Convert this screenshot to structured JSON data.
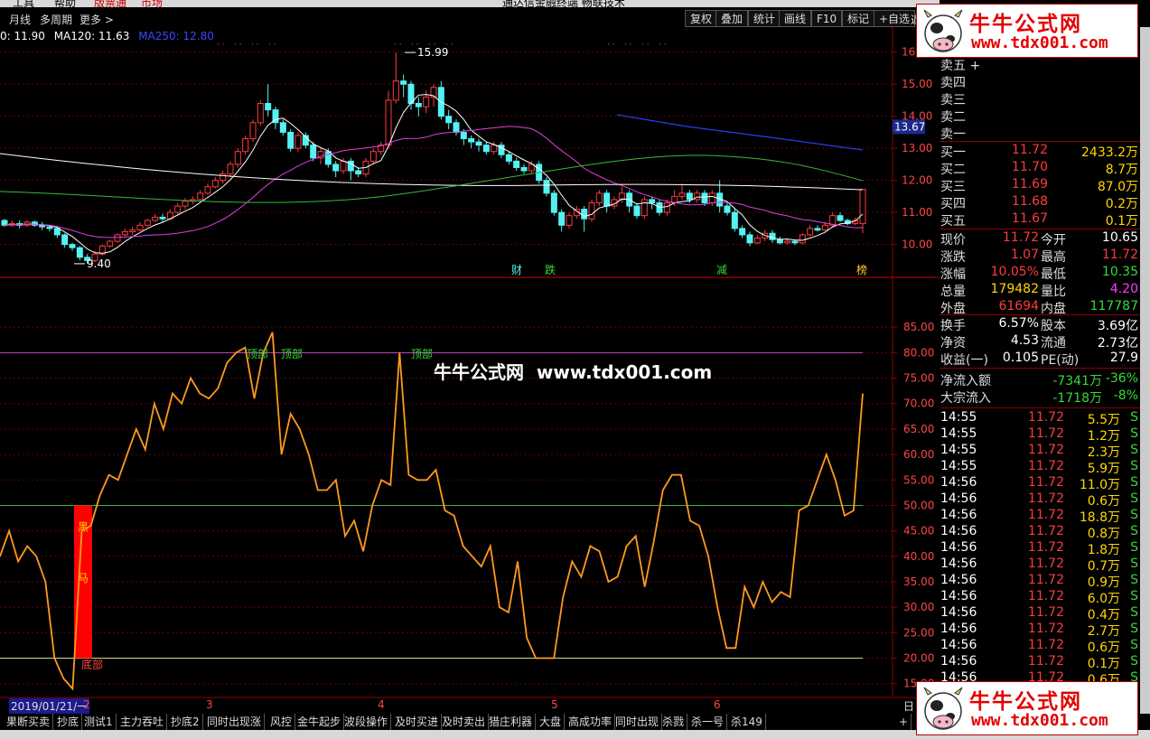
{
  "menu": {
    "items": [
      "工具",
      "帮助",
      "版票通",
      "市场"
    ],
    "center_title": "通达信金融终端 畅联技术"
  },
  "toolbar": {
    "left": [
      "月线",
      "多周期",
      "更多 >"
    ],
    "buttons": [
      "复权",
      "叠加",
      "统计",
      "画线",
      "F10",
      "标记",
      "+自选"
    ],
    "trail": "返"
  },
  "ma_legend": [
    {
      "text": "0: 11.90",
      "color": "#ffffff"
    },
    {
      "text": "MA120: 11.63",
      "color": "#ffffff"
    },
    {
      "text": "MA250: 12.80",
      "color": "#3c46ff"
    }
  ],
  "colors": {
    "up": "#ff3b3b",
    "down": "#54f2f2",
    "ma_white": "#ffffff",
    "ma_magenta": "#e040e0",
    "ma_green": "#38b838",
    "ma_blue": "#2a3cf0",
    "osc": "#ff9a1e",
    "grid": "#6b0000"
  },
  "price_axis": {
    "labels": [
      "16",
      "15.00",
      "14.00",
      "13.00",
      "12.00",
      "11.00",
      "10.00"
    ],
    "values": [
      16,
      15,
      14,
      13,
      12,
      11,
      10
    ],
    "current": "13.67"
  },
  "osc_axis": {
    "labels": [
      "85.00",
      "80.00",
      "75.00",
      "70.00",
      "65.00",
      "60.00",
      "55.00",
      "50.00",
      "45.00",
      "40.00",
      "35.00",
      "30.00",
      "25.00",
      "20.00",
      "15.00"
    ],
    "values": [
      85,
      80,
      75,
      70,
      65,
      60,
      55,
      50,
      45,
      40,
      35,
      30,
      25,
      20,
      15
    ]
  },
  "annotations": {
    "high": "15.99",
    "low": "9.40",
    "signals": [
      {
        "text": "财",
        "color": "#54f2f2"
      },
      {
        "text": "跌",
        "color": "#38d838"
      },
      {
        "text": "减",
        "color": "#38d838"
      },
      {
        "text": "榜",
        "color": "#ffcc33"
      }
    ],
    "tops": [
      "顶部",
      "顶部",
      "顶部"
    ],
    "bottom": "底部",
    "bar_text": [
      "黑",
      "马"
    ]
  },
  "watermark": "牛牛公式网  www.tdx001.com",
  "logo": {
    "cn": "牛牛公式网",
    "url": "www.tdx001.com"
  },
  "time_axis": {
    "first": "2019/01/21/一",
    "labels": [
      "2",
      "3",
      "4",
      "5",
      "6"
    ],
    "right": "日线"
  },
  "tabs": [
    "果断买卖",
    "抄底",
    "测试1",
    "主力吞吐",
    "抄底2",
    "同时出现涨",
    "风控",
    "金牛起步",
    "波段操作",
    "及时买进",
    "及时卖出",
    "猎庄利器",
    "大盘",
    "高成功率",
    "同时出现",
    "杀戮",
    "杀一号",
    "杀149",
    "+"
  ],
  "order_book": {
    "sell": [
      "卖五 +",
      "卖四",
      "卖三",
      "卖二",
      "卖一"
    ],
    "buy": [
      {
        "label": "买一",
        "price": "11.72",
        "vol": "2433.2万"
      },
      {
        "label": "买二",
        "price": "11.70",
        "vol": "8.7万"
      },
      {
        "label": "买三",
        "price": "11.69",
        "vol": "87.0万"
      },
      {
        "label": "买四",
        "price": "11.68",
        "vol": "0.2万"
      },
      {
        "label": "买五",
        "price": "11.67",
        "vol": "0.1万"
      }
    ]
  },
  "quote": [
    {
      "l1": "现价",
      "v1": "11.72",
      "c1": "#ff3b3b",
      "l2": "今开",
      "v2": "10.65",
      "c2": "#ffffff"
    },
    {
      "l1": "涨跌",
      "v1": "1.07",
      "c1": "#ff3b3b",
      "l2": "最高",
      "v2": "11.72",
      "c2": "#ff3b3b"
    },
    {
      "l1": "涨幅",
      "v1": "10.05%",
      "c1": "#ff3b3b",
      "l2": "最低",
      "v2": "10.35",
      "c2": "#38d838"
    },
    {
      "l1": "总量",
      "v1": "179482",
      "c1": "#ffd700",
      "l2": "量比",
      "v2": "4.20",
      "c2": "#ff3bff"
    },
    {
      "l1": "外盘",
      "v1": "61694",
      "c1": "#ff3b3b",
      "l2": "内盘",
      "v2": "117787",
      "c2": "#38d838"
    }
  ],
  "fund": [
    {
      "l1": "换手",
      "v1": "6.57%",
      "l2": "股本",
      "v2": "3.69亿"
    },
    {
      "l1": "净资",
      "v1": "4.53",
      "l2": "流通",
      "v2": "2.73亿"
    },
    {
      "l1": "收益(一)",
      "v1": "0.105",
      "l2": "PE(动)",
      "v2": "27.9"
    }
  ],
  "flows": [
    {
      "label": "净流入额",
      "value": "-7341万",
      "pct": "-36%"
    },
    {
      "label": "大宗流入",
      "value": "-1718万",
      "pct": "-8%"
    }
  ],
  "ticks": [
    {
      "t": "14:55",
      "p": "11.72",
      "v": "5.5万",
      "s": "S"
    },
    {
      "t": "14:55",
      "p": "11.72",
      "v": "1.2万",
      "s": "S"
    },
    {
      "t": "14:55",
      "p": "11.72",
      "v": "2.3万",
      "s": "S"
    },
    {
      "t": "14:55",
      "p": "11.72",
      "v": "5.9万",
      "s": "S"
    },
    {
      "t": "14:56",
      "p": "11.72",
      "v": "11.0万",
      "s": "S"
    },
    {
      "t": "14:56",
      "p": "11.72",
      "v": "0.6万",
      "s": "S"
    },
    {
      "t": "14:56",
      "p": "11.72",
      "v": "18.8万",
      "s": "S"
    },
    {
      "t": "14:56",
      "p": "11.72",
      "v": "0.8万",
      "s": "S"
    },
    {
      "t": "14:56",
      "p": "11.72",
      "v": "1.8万",
      "s": "S"
    },
    {
      "t": "14:56",
      "p": "11.72",
      "v": "0.7万",
      "s": "S"
    },
    {
      "t": "14:56",
      "p": "11.72",
      "v": "0.9万",
      "s": "S"
    },
    {
      "t": "14:56",
      "p": "11.72",
      "v": "6.0万",
      "s": "S"
    },
    {
      "t": "14:56",
      "p": "11.72",
      "v": "0.4万",
      "s": "S"
    },
    {
      "t": "14:56",
      "p": "11.72",
      "v": "2.7万",
      "s": "S"
    },
    {
      "t": "14:56",
      "p": "11.72",
      "v": "0.6万",
      "s": "S"
    },
    {
      "t": "14:56",
      "p": "11.72",
      "v": "0.1万",
      "s": "S"
    },
    {
      "t": "14:56",
      "p": "11.72",
      "v": "0.6万",
      "s": "S"
    }
  ],
  "chart_data": {
    "type": "candlestick",
    "candles": [
      [
        10.75,
        10.6,
        10.8,
        10.55
      ],
      [
        10.6,
        10.65,
        10.75,
        10.55
      ],
      [
        10.65,
        10.6,
        10.75,
        10.5
      ],
      [
        10.6,
        10.7,
        10.75,
        10.55
      ],
      [
        10.7,
        10.6,
        10.75,
        10.55
      ],
      [
        10.6,
        10.55,
        10.7,
        10.45
      ],
      [
        10.55,
        10.5,
        10.6,
        10.4
      ],
      [
        10.5,
        10.3,
        10.55,
        10.2
      ],
      [
        10.3,
        10.0,
        10.35,
        9.9
      ],
      [
        10.0,
        9.9,
        10.05,
        9.8
      ],
      [
        9.9,
        9.6,
        9.95,
        9.5
      ],
      [
        9.6,
        9.5,
        9.7,
        9.4
      ],
      [
        9.5,
        9.7,
        9.8,
        9.45
      ],
      [
        9.7,
        9.95,
        10.0,
        9.65
      ],
      [
        9.95,
        10.1,
        10.15,
        9.9
      ],
      [
        10.1,
        10.3,
        10.35,
        10.05
      ],
      [
        10.3,
        10.4,
        10.5,
        10.25
      ],
      [
        10.4,
        10.45,
        10.55,
        10.3
      ],
      [
        10.45,
        10.6,
        10.7,
        10.4
      ],
      [
        10.6,
        10.75,
        10.8,
        10.55
      ],
      [
        10.75,
        10.85,
        10.95,
        10.7
      ],
      [
        10.85,
        10.8,
        10.95,
        10.7
      ],
      [
        10.8,
        11.0,
        11.1,
        10.75
      ],
      [
        11.0,
        11.2,
        11.3,
        10.95
      ],
      [
        11.2,
        11.35,
        11.45,
        11.1
      ],
      [
        11.35,
        11.4,
        11.5,
        11.25
      ],
      [
        11.4,
        11.6,
        11.7,
        11.35
      ],
      [
        11.6,
        11.8,
        11.9,
        11.55
      ],
      [
        11.8,
        12.0,
        12.1,
        11.75
      ],
      [
        12.0,
        12.2,
        12.3,
        11.9
      ],
      [
        12.2,
        12.5,
        12.6,
        12.1
      ],
      [
        12.5,
        12.9,
        13.0,
        12.4
      ],
      [
        12.9,
        13.3,
        13.4,
        12.8
      ],
      [
        13.3,
        13.8,
        13.9,
        13.2
      ],
      [
        13.8,
        14.4,
        14.5,
        13.7
      ],
      [
        14.4,
        14.2,
        15.0,
        14.0
      ],
      [
        14.2,
        13.8,
        14.3,
        13.6
      ],
      [
        13.8,
        13.5,
        13.9,
        13.4
      ],
      [
        13.5,
        13.0,
        13.6,
        12.9
      ],
      [
        13.0,
        13.4,
        13.5,
        12.9
      ],
      [
        13.4,
        13.1,
        13.5,
        13.0
      ],
      [
        13.1,
        12.7,
        13.2,
        12.6
      ],
      [
        12.7,
        12.9,
        13.0,
        12.5
      ],
      [
        12.9,
        12.5,
        13.0,
        12.4
      ],
      [
        12.5,
        12.3,
        12.6,
        12.1
      ],
      [
        12.3,
        12.6,
        12.7,
        12.2
      ],
      [
        12.6,
        12.3,
        12.7,
        12.0
      ],
      [
        12.3,
        12.2,
        12.4,
        12.1
      ],
      [
        12.2,
        12.6,
        12.7,
        12.1
      ],
      [
        12.6,
        12.9,
        13.0,
        12.5
      ],
      [
        12.9,
        13.1,
        13.2,
        12.8
      ],
      [
        13.1,
        14.5,
        14.8,
        13.0
      ],
      [
        14.5,
        15.1,
        15.99,
        14.4
      ],
      [
        15.1,
        15.0,
        15.3,
        14.6
      ],
      [
        15.0,
        14.4,
        15.1,
        14.2
      ],
      [
        14.4,
        14.3,
        14.6,
        14.0
      ],
      [
        14.3,
        14.6,
        14.8,
        14.1
      ],
      [
        14.6,
        14.9,
        15.0,
        14.3
      ],
      [
        14.9,
        14.0,
        15.1,
        13.9
      ],
      [
        14.0,
        13.8,
        14.2,
        13.6
      ],
      [
        13.8,
        13.5,
        13.9,
        13.4
      ],
      [
        13.5,
        13.3,
        13.6,
        13.1
      ],
      [
        13.3,
        13.2,
        13.4,
        13.0
      ],
      [
        13.2,
        13.1,
        13.3,
        12.9
      ],
      [
        13.1,
        12.9,
        13.2,
        12.8
      ],
      [
        12.9,
        13.1,
        13.2,
        12.8
      ],
      [
        13.1,
        12.8,
        13.2,
        12.7
      ],
      [
        12.8,
        12.6,
        12.9,
        12.5
      ],
      [
        12.6,
        12.4,
        12.7,
        12.3
      ],
      [
        12.4,
        12.3,
        12.5,
        12.2
      ],
      [
        12.3,
        12.5,
        12.6,
        12.2
      ],
      [
        12.5,
        12.0,
        12.6,
        11.9
      ],
      [
        12.0,
        11.6,
        12.1,
        11.5
      ],
      [
        11.6,
        11.0,
        11.7,
        10.9
      ],
      [
        11.0,
        10.6,
        11.1,
        10.4
      ],
      [
        10.6,
        10.9,
        11.0,
        10.5
      ],
      [
        10.9,
        11.1,
        11.2,
        10.8
      ],
      [
        11.1,
        10.8,
        11.2,
        10.4
      ],
      [
        10.8,
        11.3,
        11.4,
        10.7
      ],
      [
        11.3,
        11.6,
        11.7,
        11.2
      ],
      [
        11.6,
        11.2,
        11.7,
        11.0
      ],
      [
        11.2,
        11.4,
        11.5,
        11.1
      ],
      [
        11.4,
        11.6,
        11.8,
        11.3
      ],
      [
        11.6,
        11.2,
        11.7,
        11.0
      ],
      [
        11.2,
        10.9,
        11.3,
        10.8
      ],
      [
        10.9,
        11.4,
        11.5,
        10.8
      ],
      [
        11.4,
        11.3,
        11.5,
        11.1
      ],
      [
        11.3,
        11.0,
        11.4,
        10.9
      ],
      [
        11.0,
        11.3,
        11.4,
        10.9
      ],
      [
        11.3,
        11.5,
        11.7,
        11.2
      ],
      [
        11.5,
        11.6,
        11.9,
        11.4
      ],
      [
        11.6,
        11.4,
        11.7,
        11.3
      ],
      [
        11.4,
        11.6,
        11.7,
        11.3
      ],
      [
        11.6,
        11.3,
        11.7,
        11.2
      ],
      [
        11.3,
        11.6,
        11.7,
        11.2
      ],
      [
        11.6,
        11.2,
        12.0,
        11.0
      ],
      [
        11.2,
        11.0,
        11.3,
        10.9
      ],
      [
        11.0,
        10.5,
        11.1,
        10.4
      ],
      [
        10.5,
        10.3,
        10.6,
        10.2
      ],
      [
        10.3,
        10.05,
        10.4,
        9.95
      ],
      [
        10.05,
        10.2,
        10.3,
        10.0
      ],
      [
        10.2,
        10.35,
        10.45,
        10.1
      ],
      [
        10.35,
        10.15,
        10.45,
        10.05
      ],
      [
        10.15,
        10.05,
        10.25,
        10.0
      ],
      [
        10.05,
        10.1,
        10.2,
        10.0
      ],
      [
        10.1,
        10.05,
        10.15,
        9.98
      ],
      [
        10.05,
        10.3,
        10.35,
        10.0
      ],
      [
        10.3,
        10.5,
        10.6,
        10.25
      ],
      [
        10.5,
        10.45,
        10.6,
        10.4
      ],
      [
        10.45,
        10.6,
        10.7,
        10.4
      ],
      [
        10.6,
        10.9,
        11.0,
        10.55
      ],
      [
        10.9,
        10.75,
        11.0,
        10.7
      ],
      [
        10.75,
        10.65,
        10.8,
        10.6
      ],
      [
        10.65,
        10.75,
        10.85,
        10.6
      ],
      [
        10.65,
        11.72,
        11.72,
        10.35
      ]
    ],
    "osc_values": [
      40,
      45,
      39,
      42,
      40,
      35,
      20,
      16,
      14,
      45,
      46,
      52,
      56,
      55,
      60,
      65,
      61,
      70,
      65,
      72,
      70,
      75,
      72,
      71,
      73,
      78,
      80,
      81,
      71,
      80,
      84,
      60,
      68,
      65,
      60,
      53,
      53,
      55,
      44,
      47,
      41,
      50,
      55,
      54,
      80,
      56,
      55,
      55,
      57,
      49,
      48,
      42,
      40,
      38,
      42,
      30,
      29,
      39,
      24,
      20,
      20,
      20,
      32,
      39,
      36,
      42,
      41,
      35,
      36,
      42,
      44,
      34,
      43,
      53,
      56,
      56,
      47,
      46,
      40,
      30,
      22,
      22,
      34,
      30,
      35,
      31,
      33,
      32,
      49,
      50,
      55,
      60,
      55,
      48,
      49,
      72
    ],
    "ylim_price": [
      9.2,
      16.5
    ],
    "ylim_osc": [
      13,
      90
    ]
  }
}
